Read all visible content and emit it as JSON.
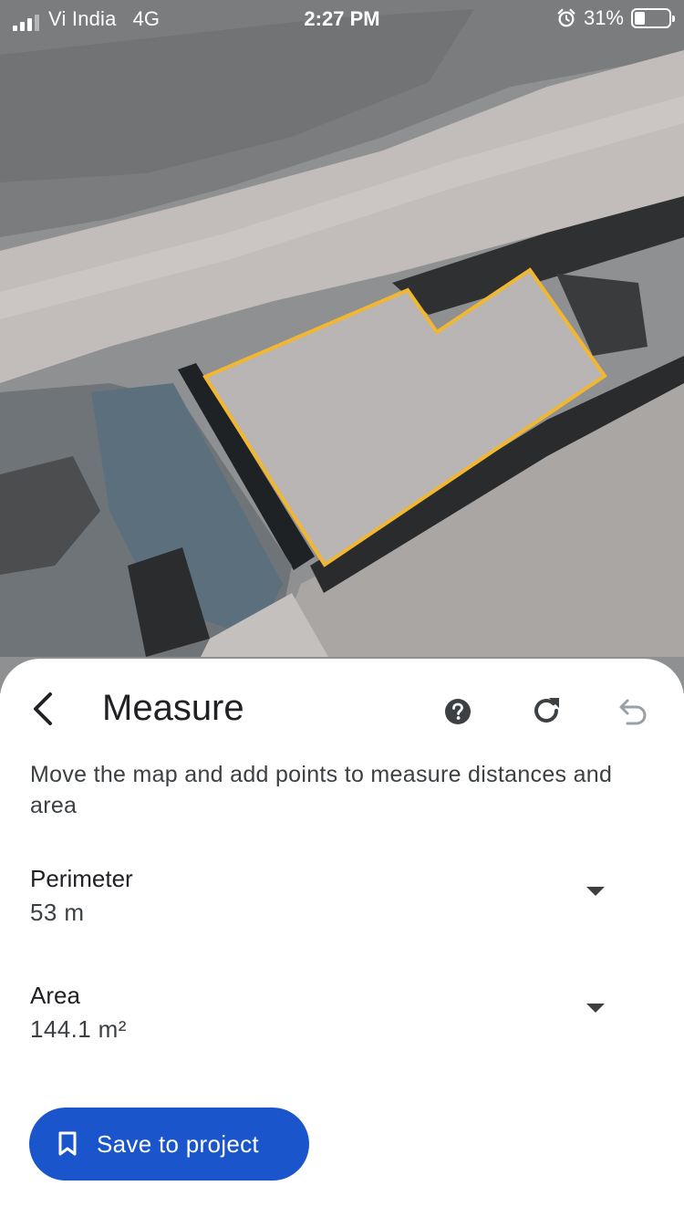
{
  "status_bar": {
    "carrier": "Vi India",
    "network": "4G",
    "time": "2:27 PM",
    "battery_percent": "31%",
    "battery_level": 0.31
  },
  "map": {
    "outline_color": "#f2b731"
  },
  "sheet": {
    "title": "Measure",
    "instructions": "Move the map and add points to measure distances and area",
    "perimeter": {
      "label": "Perimeter",
      "value": "53 m"
    },
    "area": {
      "label": "Area",
      "value": "144.1 m²"
    },
    "save_label": "Save to project",
    "accent_color": "#1a55cc"
  },
  "icons": {
    "back": "chevron-left-icon",
    "help": "help-icon",
    "refresh": "refresh-icon",
    "undo": "undo-icon",
    "save": "bookmark-icon",
    "dropdown": "caret-down-icon"
  }
}
